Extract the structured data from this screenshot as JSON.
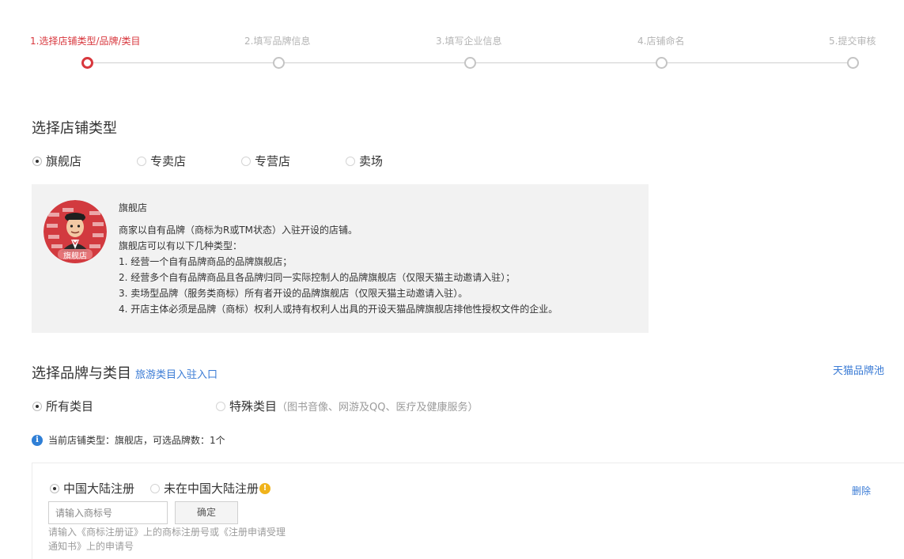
{
  "steps": [
    {
      "label": "1.选择店铺类型/品牌/类目",
      "active": true
    },
    {
      "label": "2.填写品牌信息",
      "active": false
    },
    {
      "label": "3.填写企业信息",
      "active": false
    },
    {
      "label": "4.店铺命名",
      "active": false
    },
    {
      "label": "5.提交审核",
      "active": false
    }
  ],
  "store_type": {
    "title": "选择店铺类型",
    "options": [
      "旗舰店",
      "专卖店",
      "专营店",
      "卖场"
    ],
    "selected": "旗舰店"
  },
  "store_info": {
    "avatar_caption": "旗舰店",
    "title": "旗舰店",
    "lines": [
      "商家以自有品牌（商标为R或TM状态）入驻开设的店铺。",
      "旗舰店可以有以下几种类型：",
      "1. 经营一个自有品牌商品的品牌旗舰店；",
      "2. 经营多个自有品牌商品且各品牌归同一实际控制人的品牌旗舰店（仅限天猫主动邀请入驻）；",
      "3. 卖场型品牌（服务类商标）所有者开设的品牌旗舰店（仅限天猫主动邀请入驻）。",
      "4. 开店主体必须是品牌（商标）权利人或持有权利人出具的开设天猫品牌旗舰店排他性授权文件的企业。"
    ]
  },
  "brand_category": {
    "title": "选择品牌与类目",
    "travel_link": "旅游类目入驻入口",
    "brand_pool_link": "天猫品牌池",
    "options": {
      "all": "所有类目",
      "special": "特殊类目",
      "special_note": "（图书音像、网游及QQ、医疗及健康服务）"
    },
    "notice": "当前店铺类型：旗舰店，可选品牌数：1个"
  },
  "brand_entry": {
    "reg_cn": "中国大陆注册",
    "reg_non_cn": "未在中国大陆注册",
    "delete": "删除",
    "input_placeholder": "请输入商标号",
    "confirm": "确定",
    "hint": "请输入《商标注册证》上的商标注册号或《注册申请受理通知书》上的申请号"
  },
  "colors": {
    "accent_red": "#d8373d",
    "link_blue": "#3a7bd5",
    "warn_yellow": "#f0b31b"
  }
}
